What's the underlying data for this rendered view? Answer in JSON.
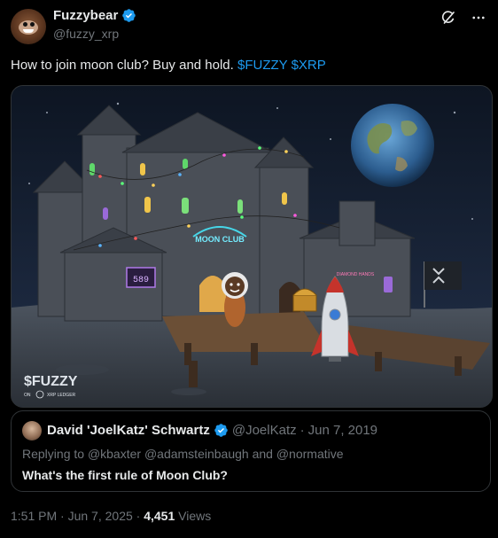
{
  "author": {
    "display_name": "Fuzzybear",
    "handle": "@fuzzy_xrp"
  },
  "tweet": {
    "text_prefix": "How to join moon club? Buy and hold.",
    "cashtag_1": "$FUZZY",
    "cashtag_2": "$XRP"
  },
  "media": {
    "sign_moon_club": "MOON CLUB",
    "sign_589": "589",
    "sign_diamond_hands": "DIAMOND HANDS",
    "brand": "$FUZZY",
    "brand_sub": "XRP LEDGER",
    "brand_on": "ON"
  },
  "quoted": {
    "display_name": "David 'JoelKatz' Schwartz",
    "handle": "@JoelKatz",
    "separator": "·",
    "date": "Jun 7, 2019",
    "reply_prefix": "Replying to",
    "mention_1": "@kbaxter",
    "mention_2": "@adamsteinbaugh",
    "and": "and",
    "mention_3": "@normative",
    "text": "What's the first rule of Moon Club?"
  },
  "footer": {
    "time": "1:51 PM",
    "date": "Jun 7, 2025",
    "separator": "·",
    "views_count": "4,451",
    "views_label": "Views"
  },
  "colors": {
    "accent": "#1d9bf0",
    "background": "#000000",
    "muted": "#71767b"
  },
  "icons": [
    "verified-badge-icon",
    "grok-icon",
    "more-icon"
  ]
}
